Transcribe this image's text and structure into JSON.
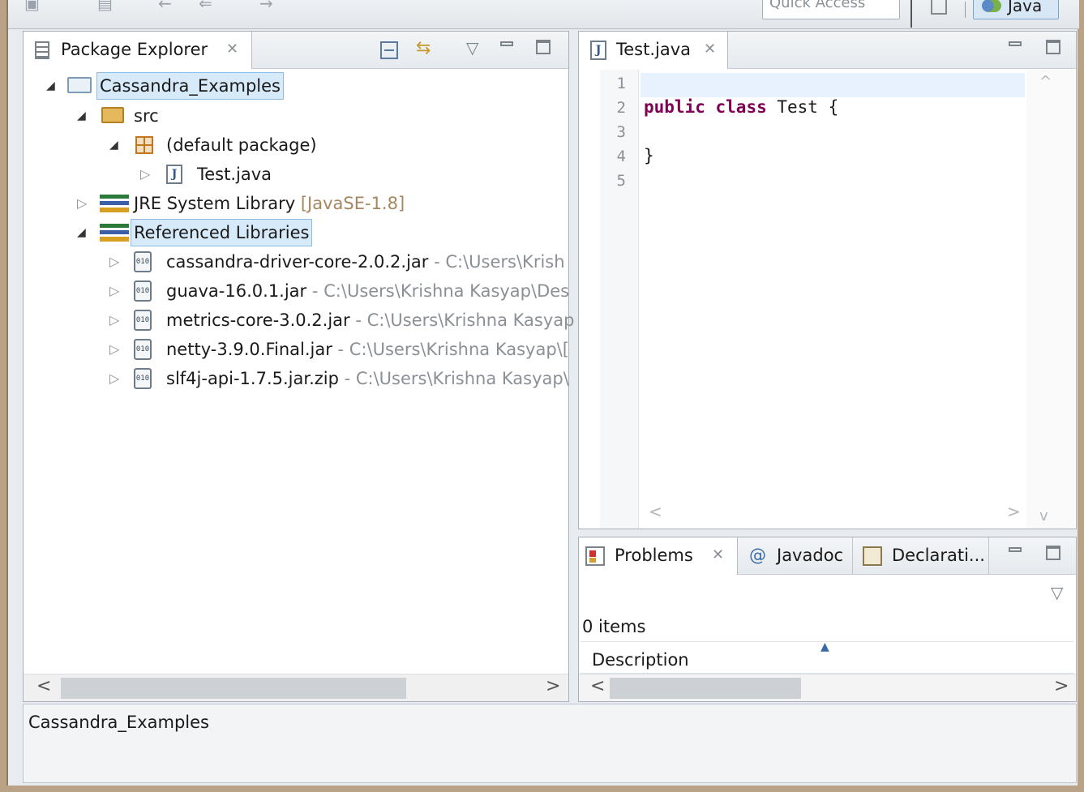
{
  "toolbar": {
    "quick_access_placeholder": "Quick Access",
    "perspective_label": "Java"
  },
  "package_explorer": {
    "tab_label": "Package Explorer",
    "tree": {
      "project": "Cassandra_Examples",
      "src": "src",
      "default_package": "(default package)",
      "test_file": "Test.java",
      "jre_name": "JRE System Library",
      "jre_version": "[JavaSE-1.8]",
      "referenced_libraries": "Referenced Libraries",
      "jars": [
        {
          "name": "cassandra-driver-core-2.0.2.jar",
          "path": " - C:\\Users\\Krish"
        },
        {
          "name": "guava-16.0.1.jar",
          "path": " - C:\\Users\\Krishna Kasyap\\Des"
        },
        {
          "name": "metrics-core-3.0.2.jar",
          "path": " - C:\\Users\\Krishna Kasyap"
        },
        {
          "name": "netty-3.9.0.Final.jar",
          "path": " - C:\\Users\\Krishna Kasyap\\["
        },
        {
          "name": "slf4j-api-1.7.5.jar.zip",
          "path": " - C:\\Users\\Krishna Kasyap\\"
        }
      ]
    }
  },
  "editor": {
    "tab_label": "Test.java",
    "line_numbers": [
      "1",
      "2",
      "3",
      "4",
      "5"
    ],
    "code": {
      "line2_kw1": "public",
      "line2_kw2": "class",
      "line2_rest": " Test {",
      "line4": "}"
    }
  },
  "problems": {
    "tabs": {
      "problems": "Problems",
      "javadoc": "Javadoc",
      "declaration": "Declarati..."
    },
    "item_count": "0 items",
    "column_description": "Description"
  },
  "status_bar": {
    "text": "Cassandra_Examples"
  },
  "icons": {
    "close": "✕",
    "view_menu": "▽",
    "scroll_left": "<",
    "scroll_right": ">",
    "scroll_up": "^",
    "scroll_down": "v"
  }
}
